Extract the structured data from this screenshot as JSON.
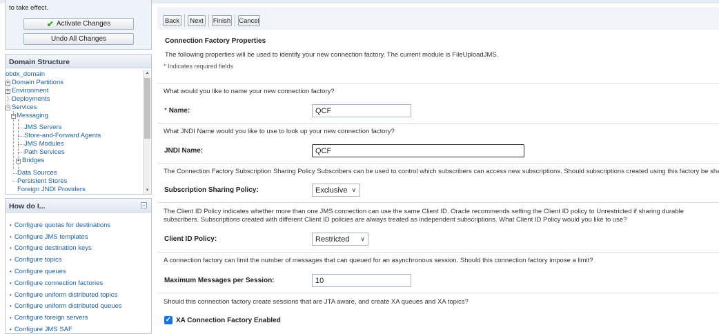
{
  "change_center": {
    "text": "to take effect.",
    "activate_label": "Activate Changes",
    "undo_label": "Undo All Changes"
  },
  "domain_structure": {
    "title": "Domain Structure",
    "items": [
      {
        "label": "obdx_domain"
      },
      {
        "label": "Domain Partitions"
      },
      {
        "label": "Environment"
      },
      {
        "label": "Deployments"
      },
      {
        "label": "Services"
      },
      {
        "label": "Messaging"
      },
      {
        "label": "JMS Servers"
      },
      {
        "label": "Store-and-Forward Agents"
      },
      {
        "label": "JMS Modules"
      },
      {
        "label": "Path Services"
      },
      {
        "label": "Bridges"
      },
      {
        "label": "Data Sources"
      },
      {
        "label": "Persistent Stores"
      },
      {
        "label": "Foreign JNDI Providers"
      }
    ]
  },
  "how_do_i": {
    "title": "How do I...",
    "items": [
      "Configure quotas for destinations",
      "Configure JMS templates",
      "Configure destination keys",
      "Configure topics",
      "Configure queues",
      "Configure connection factories",
      "Configure uniform distributed topics",
      "Configure uniform distributed queues",
      "Configure foreign servers",
      "Configure JMS SAF"
    ]
  },
  "toolbar": {
    "back": "Back",
    "next": "Next",
    "finish": "Finish",
    "cancel": "Cancel"
  },
  "form": {
    "section_title": "Connection Factory Properties",
    "intro": "The following properties will be used to identify your new connection factory. The current module is FileUploadJMS.",
    "required_note": "* Indicates required fields",
    "name_question": "What would you like to name your new connection factory?",
    "name_label": "Name:",
    "name_star": "*",
    "name_value": "QCF",
    "jndi_question": "What JNDI Name would you like to use to look up your new connection factory?",
    "jndi_label": "JNDI Name:",
    "jndi_value": "QCF",
    "sharing_question": "The Connection Factory Subscription Sharing Policy Subscribers can be used to control which subscribers can access new subscriptions. Should subscriptions created using this factory be sharable?",
    "sharing_label": "Subscription Sharing Policy:",
    "sharing_value": "Exclusive",
    "clientid_question": "The Client ID Policy indicates whether more than one JMS connection can use the same Client ID. Oracle recommends setting the Client ID policy to Unrestricted if sharing durable subscribers. Subscriptions created with different Client ID policies are always treated as independent subscriptions. What Client ID Policy would you like to use?",
    "clientid_label": "Client ID Policy:",
    "clientid_value": "Restricted",
    "maxmsg_question": "A connection factory can limit the number of messages that can queued for an asynchronous session. Should this connection factory impose a limit?",
    "maxmsg_label": "Maximum Messages per Session:",
    "maxmsg_value": "10",
    "xa_question": "Should this connection factory create sessions that are JTA aware, and create XA queues and XA topics?",
    "xa_label": "XA Connection Factory Enabled",
    "xa_checked": true
  }
}
